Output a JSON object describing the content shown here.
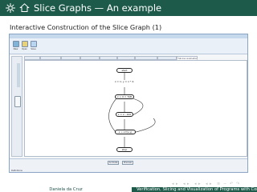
{
  "slide": {
    "title": "Slice Graphs — An example",
    "subtitle": "Interactive Construction of the Slice Graph (1)",
    "colors": {
      "header": "#1e5a4a",
      "text": "#ffffff"
    }
  },
  "app": {
    "toolbar": [
      "New",
      "Open",
      "Save"
    ],
    "tabs": [
      "",
      "",
      "",
      "",
      "",
      "",
      "",
      "",
      "Slicing Animation"
    ],
    "sidebar_label": "",
    "nodes": [
      "start",
      "x = 1;\ny = x * 2;",
      "x < 0 = TAB",
      "x = z - 100",
      "x < z  f(x,y)",
      "stop"
    ],
    "footer_buttons": [
      "Animate",
      "Preview"
    ],
    "footer_label": "Definitions"
  },
  "navigation": [
    "◂",
    "▸",
    "◂",
    "▸",
    "◂",
    "▸",
    "◂",
    "▸",
    "≡",
    "∽",
    "↶",
    "↷"
  ],
  "footline": {
    "author": "Daniela da Cruz",
    "title": "Verification, Slicing and Visualization of Programs with Contracts"
  }
}
